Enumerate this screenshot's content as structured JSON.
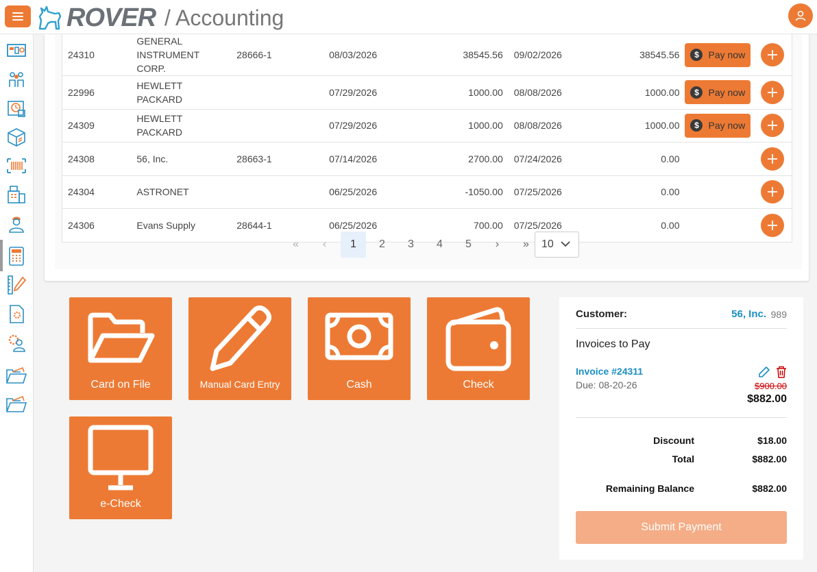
{
  "app": {
    "brand": "ROVER",
    "section": "/ Accounting"
  },
  "colors": {
    "accent": "#ed7a34",
    "link": "#1a8fc2",
    "danger": "#cc0000"
  },
  "sidebar": {
    "items": [
      {
        "icon": "dashboard-icon"
      },
      {
        "icon": "users-group-icon"
      },
      {
        "icon": "schedule-icon"
      },
      {
        "icon": "package-icon"
      },
      {
        "icon": "barcode-icon"
      },
      {
        "icon": "register-icon"
      },
      {
        "icon": "technician-icon"
      },
      {
        "icon": "calculator-icon",
        "active": true
      },
      {
        "icon": "ruler-pencil-icon"
      },
      {
        "icon": "document-settings-icon"
      },
      {
        "icon": "user-settings-icon"
      },
      {
        "icon": "folder-icon"
      },
      {
        "icon": "folder-icon"
      }
    ]
  },
  "invoices": {
    "pay_label": "Pay now",
    "rows": [
      {
        "id": "24310",
        "customer": "GENERAL INSTRUMENT CORP.",
        "po": "28666-1",
        "date": "08/03/2026",
        "amount": "38545.56",
        "due": "09/02/2026",
        "balance": "38545.56",
        "payable": true
      },
      {
        "id": "22996",
        "customer": "HEWLETT PACKARD",
        "po": "",
        "date": "07/29/2026",
        "amount": "1000.00",
        "due": "08/08/2026",
        "balance": "1000.00",
        "payable": true
      },
      {
        "id": "24309",
        "customer": "HEWLETT PACKARD",
        "po": "",
        "date": "07/29/2026",
        "amount": "1000.00",
        "due": "08/08/2026",
        "balance": "1000.00",
        "payable": true
      },
      {
        "id": "24308",
        "customer": "56, Inc.",
        "po": "28663-1",
        "date": "07/14/2026",
        "amount": "2700.00",
        "due": "07/24/2026",
        "balance": "0.00",
        "payable": false
      },
      {
        "id": "24304",
        "customer": "ASTRONET",
        "po": "",
        "date": "06/25/2026",
        "amount": "-1050.00",
        "due": "07/25/2026",
        "balance": "0.00",
        "payable": false
      },
      {
        "id": "24306",
        "customer": "Evans Supply",
        "po": "28644-1",
        "date": "06/25/2026",
        "amount": "700.00",
        "due": "07/25/2026",
        "balance": "0.00",
        "payable": false
      }
    ]
  },
  "pagination": {
    "first": "«",
    "prev": "‹",
    "next": "›",
    "last": "»",
    "pages": [
      "1",
      "2",
      "3",
      "4",
      "5"
    ],
    "current": "1",
    "page_size": "10"
  },
  "payment_methods": [
    {
      "label": "Card on File",
      "icon": "folder-open-icon"
    },
    {
      "label": "Manual Card Entry",
      "icon": "pencil-icon"
    },
    {
      "label": "Cash",
      "icon": "cash-icon"
    },
    {
      "label": "Check",
      "icon": "wallet-icon"
    },
    {
      "label": "e-Check",
      "icon": "monitor-icon"
    }
  ],
  "summary": {
    "customer_label": "Customer:",
    "customer_name": "56, Inc.",
    "customer_number": "989",
    "invoices_title": "Invoices to Pay",
    "invoice": {
      "number": "Invoice #24311",
      "due": "Due: 08-20-26",
      "original": "$900.00",
      "amount": "$882.00"
    },
    "discount_label": "Discount",
    "discount_value": "$18.00",
    "total_label": "Total",
    "total_value": "$882.00",
    "remaining_label": "Remaining Balance",
    "remaining_value": "$882.00",
    "submit_label": "Submit Payment"
  }
}
